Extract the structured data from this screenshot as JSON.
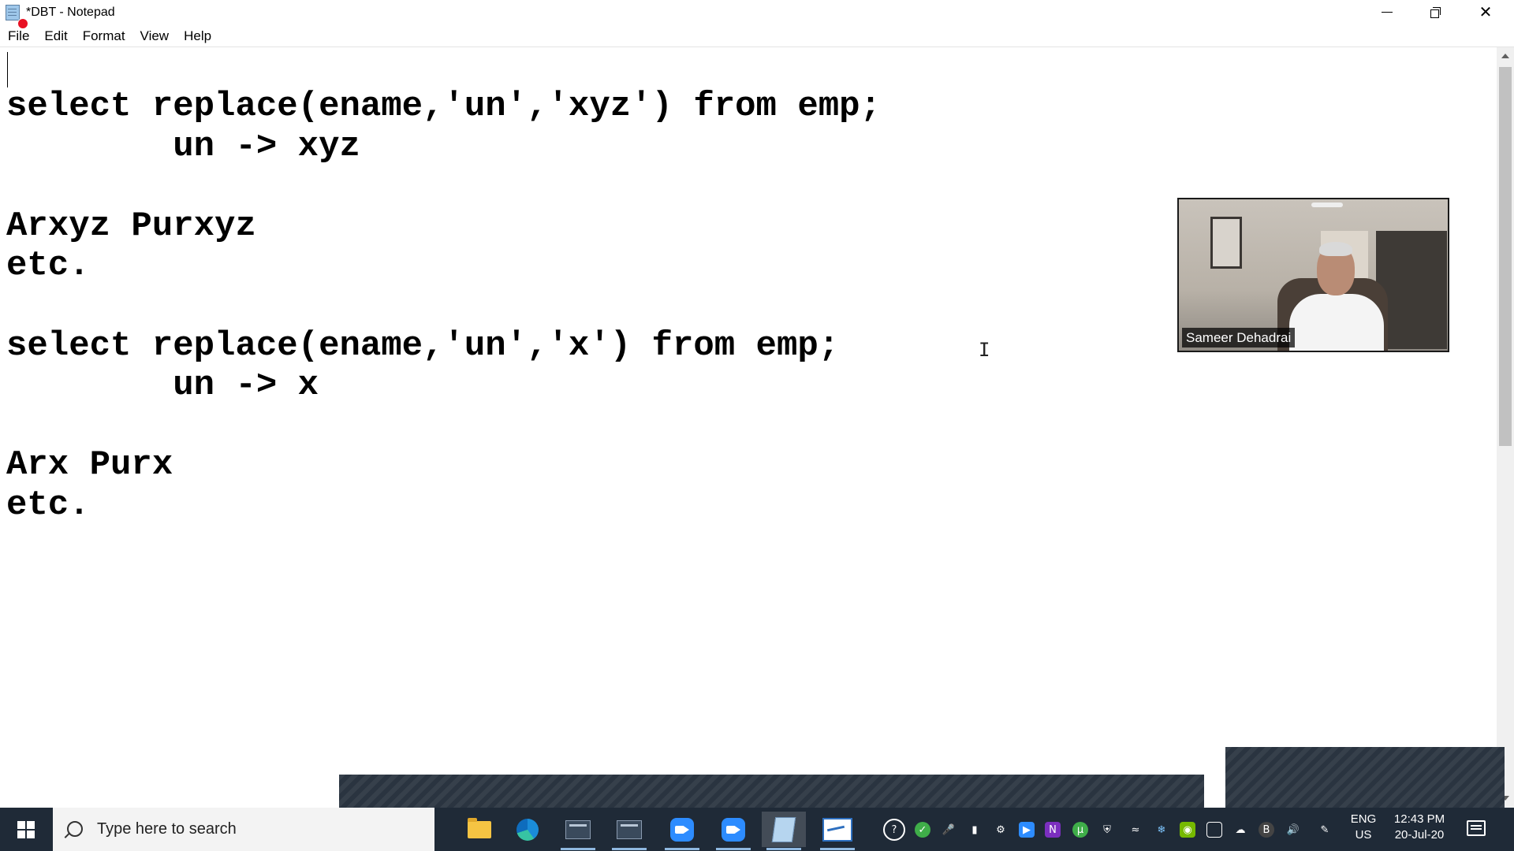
{
  "window": {
    "title": "*DBT - Notepad",
    "app_icon": "notepad-icon",
    "controls": [
      "minimize-icon",
      "restore-icon",
      "close-icon"
    ]
  },
  "menu": [
    {
      "label": "File",
      "accel": "F"
    },
    {
      "label": "Edit",
      "accel": "E"
    },
    {
      "label": "Format",
      "accel": "o"
    },
    {
      "label": "View",
      "accel": "V"
    },
    {
      "label": "Help",
      "accel": "H"
    }
  ],
  "editor": {
    "lines": [
      "select replace(ename,'un','xyz') from emp;",
      "        un -> xyz",
      "",
      "Arxyz Purxyz",
      "etc.",
      "",
      "select replace(ename,'un','x') from emp;",
      "        un -> x",
      "",
      "Arx Purx",
      "etc."
    ]
  },
  "video": {
    "participant_name": "Sameer Dehadrai"
  },
  "taskbar": {
    "search_placeholder": "Type here to search",
    "apps": [
      {
        "name": "file-explorer-icon"
      },
      {
        "name": "edge-icon"
      },
      {
        "name": "sql-console-icon"
      },
      {
        "name": "sql-console-icon"
      },
      {
        "name": "zoom-icon"
      },
      {
        "name": "zoom-icon"
      },
      {
        "name": "notepad-icon"
      },
      {
        "name": "whiteboard-icon"
      }
    ],
    "tray": {
      "lang_primary": "ENG",
      "lang_secondary": "US",
      "time": "12:43 PM",
      "date": "20-Jul-20"
    }
  },
  "colors": {
    "taskbar_bg": "#1f2a37",
    "accent": "#2d8cff"
  }
}
